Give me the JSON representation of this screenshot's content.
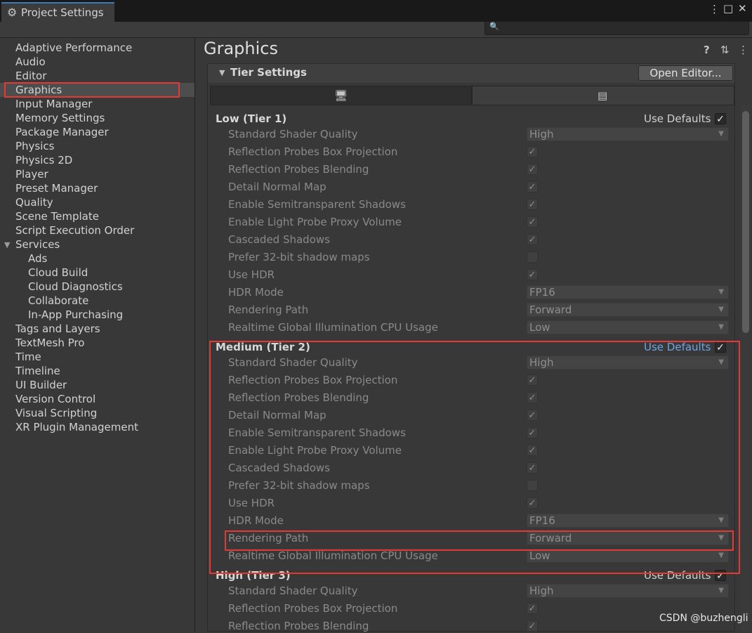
{
  "window": {
    "tab_title": "Project Settings",
    "menu_glyph": "⋮",
    "maximize_glyph": "□",
    "close_glyph": "✕",
    "gear_glyph": "⚙",
    "search_glyph": "🔍"
  },
  "sidebar": {
    "items": [
      "Adaptive Performance",
      "Audio",
      "Editor",
      "Graphics",
      "Input Manager",
      "Memory Settings",
      "Package Manager",
      "Physics",
      "Physics 2D",
      "Player",
      "Preset Manager",
      "Quality",
      "Scene Template",
      "Script Execution Order",
      "Services"
    ],
    "service_children": [
      "Ads",
      "Cloud Build",
      "Cloud Diagnostics",
      "Collaborate",
      "In-App Purchasing"
    ],
    "items_after": [
      "Tags and Layers",
      "TextMesh Pro",
      "Time",
      "Timeline",
      "UI Builder",
      "Version Control",
      "Visual Scripting",
      "XR Plugin Management"
    ],
    "selected": "Graphics"
  },
  "main": {
    "title": "Graphics",
    "help_glyph": "?",
    "preset_glyph": "⇅",
    "more_glyph": "⋮",
    "section_title": "Tier Settings",
    "open_editor_label": "Open Editor...",
    "platform_icons": {
      "standalone": "🖥",
      "mobile": "▤"
    },
    "check_glyph": "✓",
    "dropdown_arrow": "▼",
    "tiers": [
      {
        "title": "Low (Tier 1)",
        "use_defaults_label": "Use Defaults",
        "use_defaults": true,
        "props": [
          {
            "label": "Standard Shader Quality",
            "kind": "dropdown",
            "value": "High"
          },
          {
            "label": "Reflection Probes Box Projection",
            "kind": "check",
            "value": true
          },
          {
            "label": "Reflection Probes Blending",
            "kind": "check",
            "value": true
          },
          {
            "label": "Detail Normal Map",
            "kind": "check",
            "value": true
          },
          {
            "label": "Enable Semitransparent Shadows",
            "kind": "check",
            "value": true
          },
          {
            "label": "Enable Light Probe Proxy Volume",
            "kind": "check",
            "value": true
          },
          {
            "label": "Cascaded Shadows",
            "kind": "check",
            "value": true
          },
          {
            "label": "Prefer 32-bit shadow maps",
            "kind": "check",
            "value": false
          },
          {
            "label": "Use HDR",
            "kind": "check",
            "value": true
          },
          {
            "label": "HDR Mode",
            "kind": "dropdown",
            "value": "FP16"
          },
          {
            "label": "Rendering Path",
            "kind": "dropdown",
            "value": "Forward"
          },
          {
            "label": "Realtime Global Illumination CPU Usage",
            "kind": "dropdown",
            "value": "Low"
          }
        ]
      },
      {
        "title": "Medium (Tier 2)",
        "use_defaults_label": "Use Defaults",
        "use_defaults": true,
        "props": [
          {
            "label": "Standard Shader Quality",
            "kind": "dropdown",
            "value": "High"
          },
          {
            "label": "Reflection Probes Box Projection",
            "kind": "check",
            "value": true
          },
          {
            "label": "Reflection Probes Blending",
            "kind": "check",
            "value": true
          },
          {
            "label": "Detail Normal Map",
            "kind": "check",
            "value": true
          },
          {
            "label": "Enable Semitransparent Shadows",
            "kind": "check",
            "value": true
          },
          {
            "label": "Enable Light Probe Proxy Volume",
            "kind": "check",
            "value": true
          },
          {
            "label": "Cascaded Shadows",
            "kind": "check",
            "value": true
          },
          {
            "label": "Prefer 32-bit shadow maps",
            "kind": "check",
            "value": false
          },
          {
            "label": "Use HDR",
            "kind": "check",
            "value": true
          },
          {
            "label": "HDR Mode",
            "kind": "dropdown",
            "value": "FP16"
          },
          {
            "label": "Rendering Path",
            "kind": "dropdown",
            "value": "Forward"
          },
          {
            "label": "Realtime Global Illumination CPU Usage",
            "kind": "dropdown",
            "value": "Low"
          }
        ]
      },
      {
        "title": "High (Tier 3)",
        "use_defaults_label": "Use Defaults",
        "use_defaults": true,
        "props": [
          {
            "label": "Standard Shader Quality",
            "kind": "dropdown",
            "value": "High"
          },
          {
            "label": "Reflection Probes Box Projection",
            "kind": "check",
            "value": true
          },
          {
            "label": "Reflection Probes Blending",
            "kind": "check",
            "value": true
          }
        ]
      }
    ]
  },
  "watermark": "CSDN @buzhengli"
}
